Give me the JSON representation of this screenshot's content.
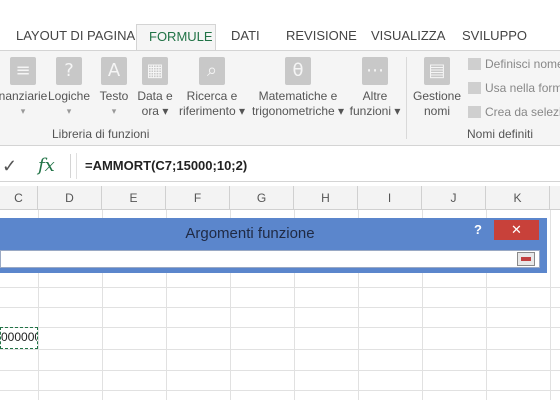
{
  "tabs": [
    {
      "label": "LAYOUT DI PAGINA",
      "active": false
    },
    {
      "label": "FORMULE",
      "active": true
    },
    {
      "label": "DATI",
      "active": false
    },
    {
      "label": "REVISIONE",
      "active": false
    },
    {
      "label": "VISUALIZZA",
      "active": false
    },
    {
      "label": "SVILUPPO",
      "active": false
    }
  ],
  "ribbon": {
    "function_library": {
      "group_label": "Libreria di funzioni",
      "buttons": [
        {
          "line1": "nanziarie",
          "line2": "▾",
          "icon": "financial-icon"
        },
        {
          "line1": "Logiche",
          "line2": "▾",
          "icon": "logical-icon"
        },
        {
          "line1": "Testo",
          "line2": "▾",
          "icon": "text-icon"
        },
        {
          "line1": "Data e",
          "line2": "ora ▾",
          "icon": "date-time-icon"
        },
        {
          "line1": "Ricerca e",
          "line2": "riferimento ▾",
          "icon": "lookup-icon"
        },
        {
          "line1": "Matematiche e",
          "line2": "trigonometriche ▾",
          "icon": "math-icon"
        },
        {
          "line1": "Altre",
          "line2": "funzioni ▾",
          "icon": "more-functions-icon"
        }
      ]
    },
    "defined_names": {
      "group_label": "Nomi definiti",
      "manager": {
        "line1": "Gestione",
        "line2": "nomi",
        "icon": "name-manager-icon"
      },
      "small_buttons": [
        "Definisci nome",
        "Usa nella form",
        "Crea da selezio"
      ]
    }
  },
  "formula_bar": {
    "confirm_glyph": "✓",
    "fx_label": "fx",
    "formula": "=AMMORT(C7;15000;10;2)"
  },
  "columns": [
    "C",
    "D",
    "E",
    "F",
    "G",
    "H",
    "I",
    "J",
    "K"
  ],
  "selected_cell_value": "000000",
  "dialog": {
    "title": "Argomenti funzione",
    "help": "?",
    "close": "✕"
  }
}
